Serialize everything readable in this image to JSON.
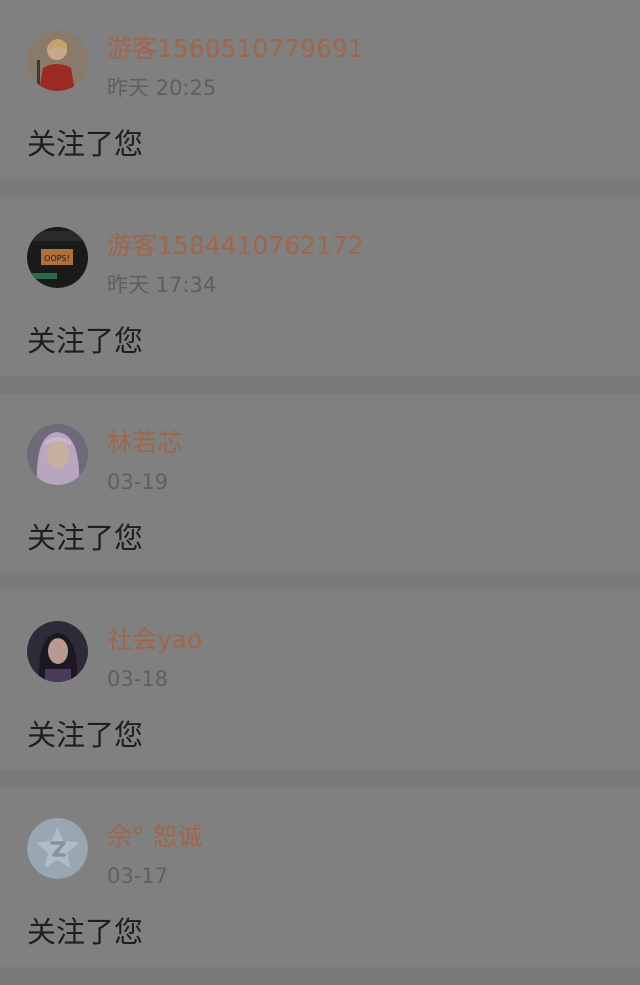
{
  "notifications": [
    {
      "name": "游客1560510779691",
      "time": "昨天 20:25",
      "message": "关注了您",
      "avatar": "avatar-photo-red-outfit"
    },
    {
      "name": "游客1584410762172",
      "time": "昨天 17:34",
      "message": "关注了您",
      "avatar": "avatar-sign-oops",
      "avatar_text": "OOPS!"
    },
    {
      "name": "林若芯",
      "time": "03-19",
      "message": "关注了您",
      "avatar": "avatar-photo-purple-hair"
    },
    {
      "name": "社会yao",
      "time": "03-18",
      "message": "关注了您",
      "avatar": "avatar-photo-dark-portrait"
    },
    {
      "name": "佘° 恕诚",
      "time": "03-17",
      "message": "关注了您",
      "avatar": "avatar-default-qq-star"
    }
  ],
  "colors": {
    "background": "#7a7a7a",
    "card": "#808080",
    "name": "#a0664a",
    "time": "#5f5f5f",
    "message": "#1e1e1e"
  }
}
